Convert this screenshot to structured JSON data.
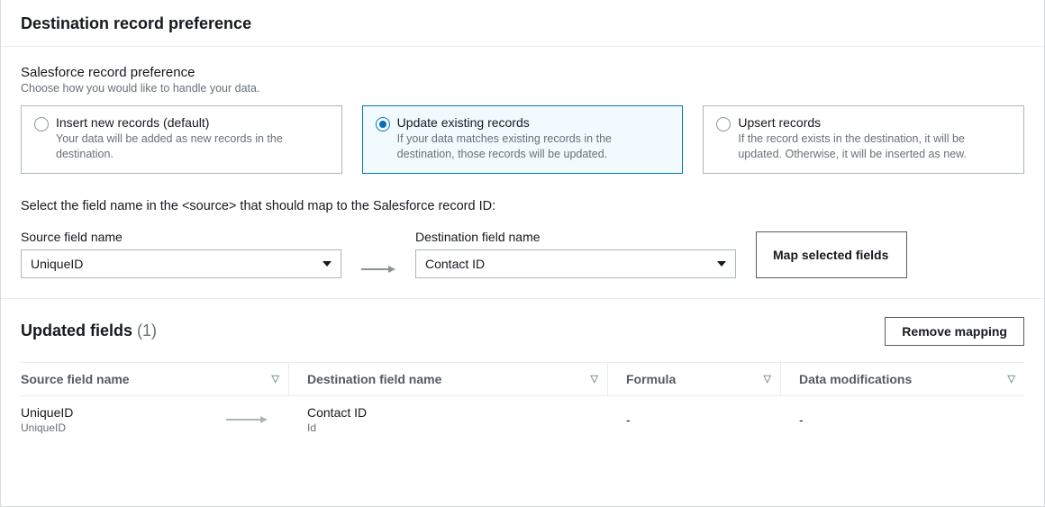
{
  "header": {
    "title": "Destination record preference"
  },
  "preference": {
    "title": "Salesforce record preference",
    "description": "Choose how you would like to handle your data.",
    "options": [
      {
        "label": "Insert new records (default)",
        "description": "Your data will be added as new records in the destination.",
        "selected": false
      },
      {
        "label": "Update existing records",
        "description": "If your data matches existing records in the destination, those records will be updated.",
        "selected": true
      },
      {
        "label": "Upsert records",
        "description": "If the record exists in the destination, it will be updated. Otherwise, it will be inserted as new.",
        "selected": false
      }
    ]
  },
  "mapping": {
    "instruction": "Select the field name in the <source> that should map to the Salesforce record ID:",
    "source_label": "Source field name",
    "source_value": "UniqueID",
    "dest_label": "Destination field name",
    "dest_value": "Contact ID",
    "map_button": "Map selected fields"
  },
  "updated": {
    "title": "Updated fields",
    "count": "(1)",
    "remove_button": "Remove mapping",
    "columns": [
      "Source field name",
      "Destination field name",
      "Formula",
      "Data modifications"
    ],
    "rows": [
      {
        "source_main": "UniqueID",
        "source_sub": "UniqueID",
        "dest_main": "Contact ID",
        "dest_sub": "Id",
        "formula": "-",
        "modifications": "-"
      }
    ]
  }
}
